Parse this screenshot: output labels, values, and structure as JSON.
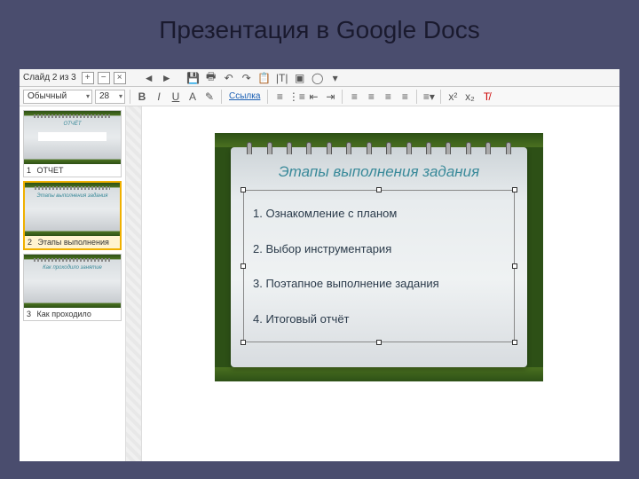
{
  "page_title": "Презентация в Google Docs",
  "status": {
    "slide_counter": "Слайд 2 из 3"
  },
  "toolbar": {
    "style_dd": "Обычный",
    "size_dd": "28",
    "link_label": "Ссылка"
  },
  "sidebar": {
    "thumbs": [
      {
        "num": "1",
        "label": "ОТЧЕТ",
        "title": "ОТЧЁТ"
      },
      {
        "num": "2",
        "label": "Этапы выполнения",
        "title": "Этапы выполнения задания"
      },
      {
        "num": "3",
        "label": "Как проходило",
        "title": "Как проходило занятие"
      }
    ]
  },
  "slide": {
    "title": "Этапы выполнения задания",
    "items": [
      "1.  Ознакомление с планом",
      "2.  Выбор инструментария",
      "3.  Поэтапное выполнение задания",
      "4.  Итоговый отчёт"
    ]
  }
}
